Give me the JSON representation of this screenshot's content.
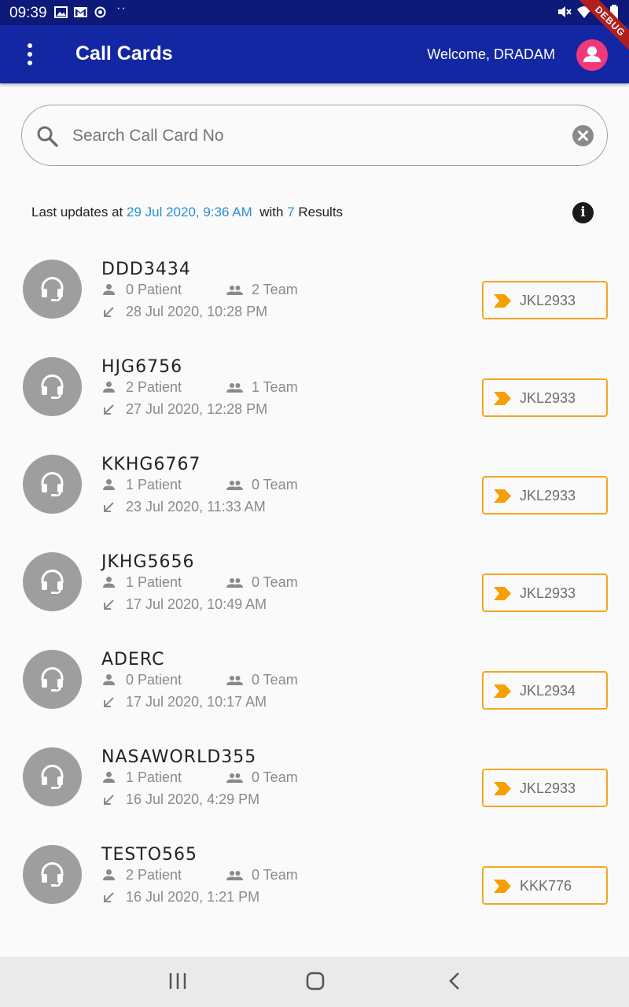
{
  "status_bar": {
    "time": "09:39",
    "dots": "··"
  },
  "debug_label": "DEBUG",
  "app_bar": {
    "title": "Call Cards",
    "welcome": "Welcome, DRADAM"
  },
  "search": {
    "placeholder": "Search Call Card No",
    "value": ""
  },
  "info": {
    "prefix": "Last updates at",
    "date": "29 Jul 2020, 9:36 AM",
    "with": "with",
    "count": "7",
    "suffix": "Results"
  },
  "colors": {
    "app_bar": "#1427a3",
    "status_bar": "#0d1a7a",
    "accent_link": "#2b8fd6",
    "tag_border": "#f5a623",
    "avatar": "#f2387d"
  },
  "icons": {
    "menu": "more-vert-icon",
    "profile": "person-icon",
    "search": "search-icon",
    "clear": "cancel-icon",
    "info": "info-icon",
    "headset": "headset-icon",
    "patient": "person-icon",
    "team": "people-icon",
    "call": "call-received-icon",
    "tag": "label-arrow-icon"
  },
  "cards": [
    {
      "no": "DDD3434",
      "patient": "0 Patient",
      "team": "2 Team",
      "date": "28 Jul 2020, 10:28 PM",
      "tag": "JKL2933"
    },
    {
      "no": "HJG6756",
      "patient": "2 Patient",
      "team": "1 Team",
      "date": "27 Jul 2020, 12:28 PM",
      "tag": "JKL2933"
    },
    {
      "no": "KKHG6767",
      "patient": "1 Patient",
      "team": "0 Team",
      "date": "23 Jul 2020, 11:33 AM",
      "tag": "JKL2933"
    },
    {
      "no": "JKHG5656",
      "patient": "1 Patient",
      "team": "0 Team",
      "date": "17 Jul 2020, 10:49 AM",
      "tag": "JKL2933"
    },
    {
      "no": "ADERC",
      "patient": "0 Patient",
      "team": "0 Team",
      "date": "17 Jul 2020, 10:17 AM",
      "tag": "JKL2934"
    },
    {
      "no": "NASAWORLD355",
      "patient": "1 Patient",
      "team": "0 Team",
      "date": "16 Jul 2020, 4:29 PM",
      "tag": "JKL2933"
    },
    {
      "no": "TESTO565",
      "patient": "2 Patient",
      "team": "0 Team",
      "date": "16 Jul 2020, 1:21 PM",
      "tag": "KKK776"
    }
  ]
}
